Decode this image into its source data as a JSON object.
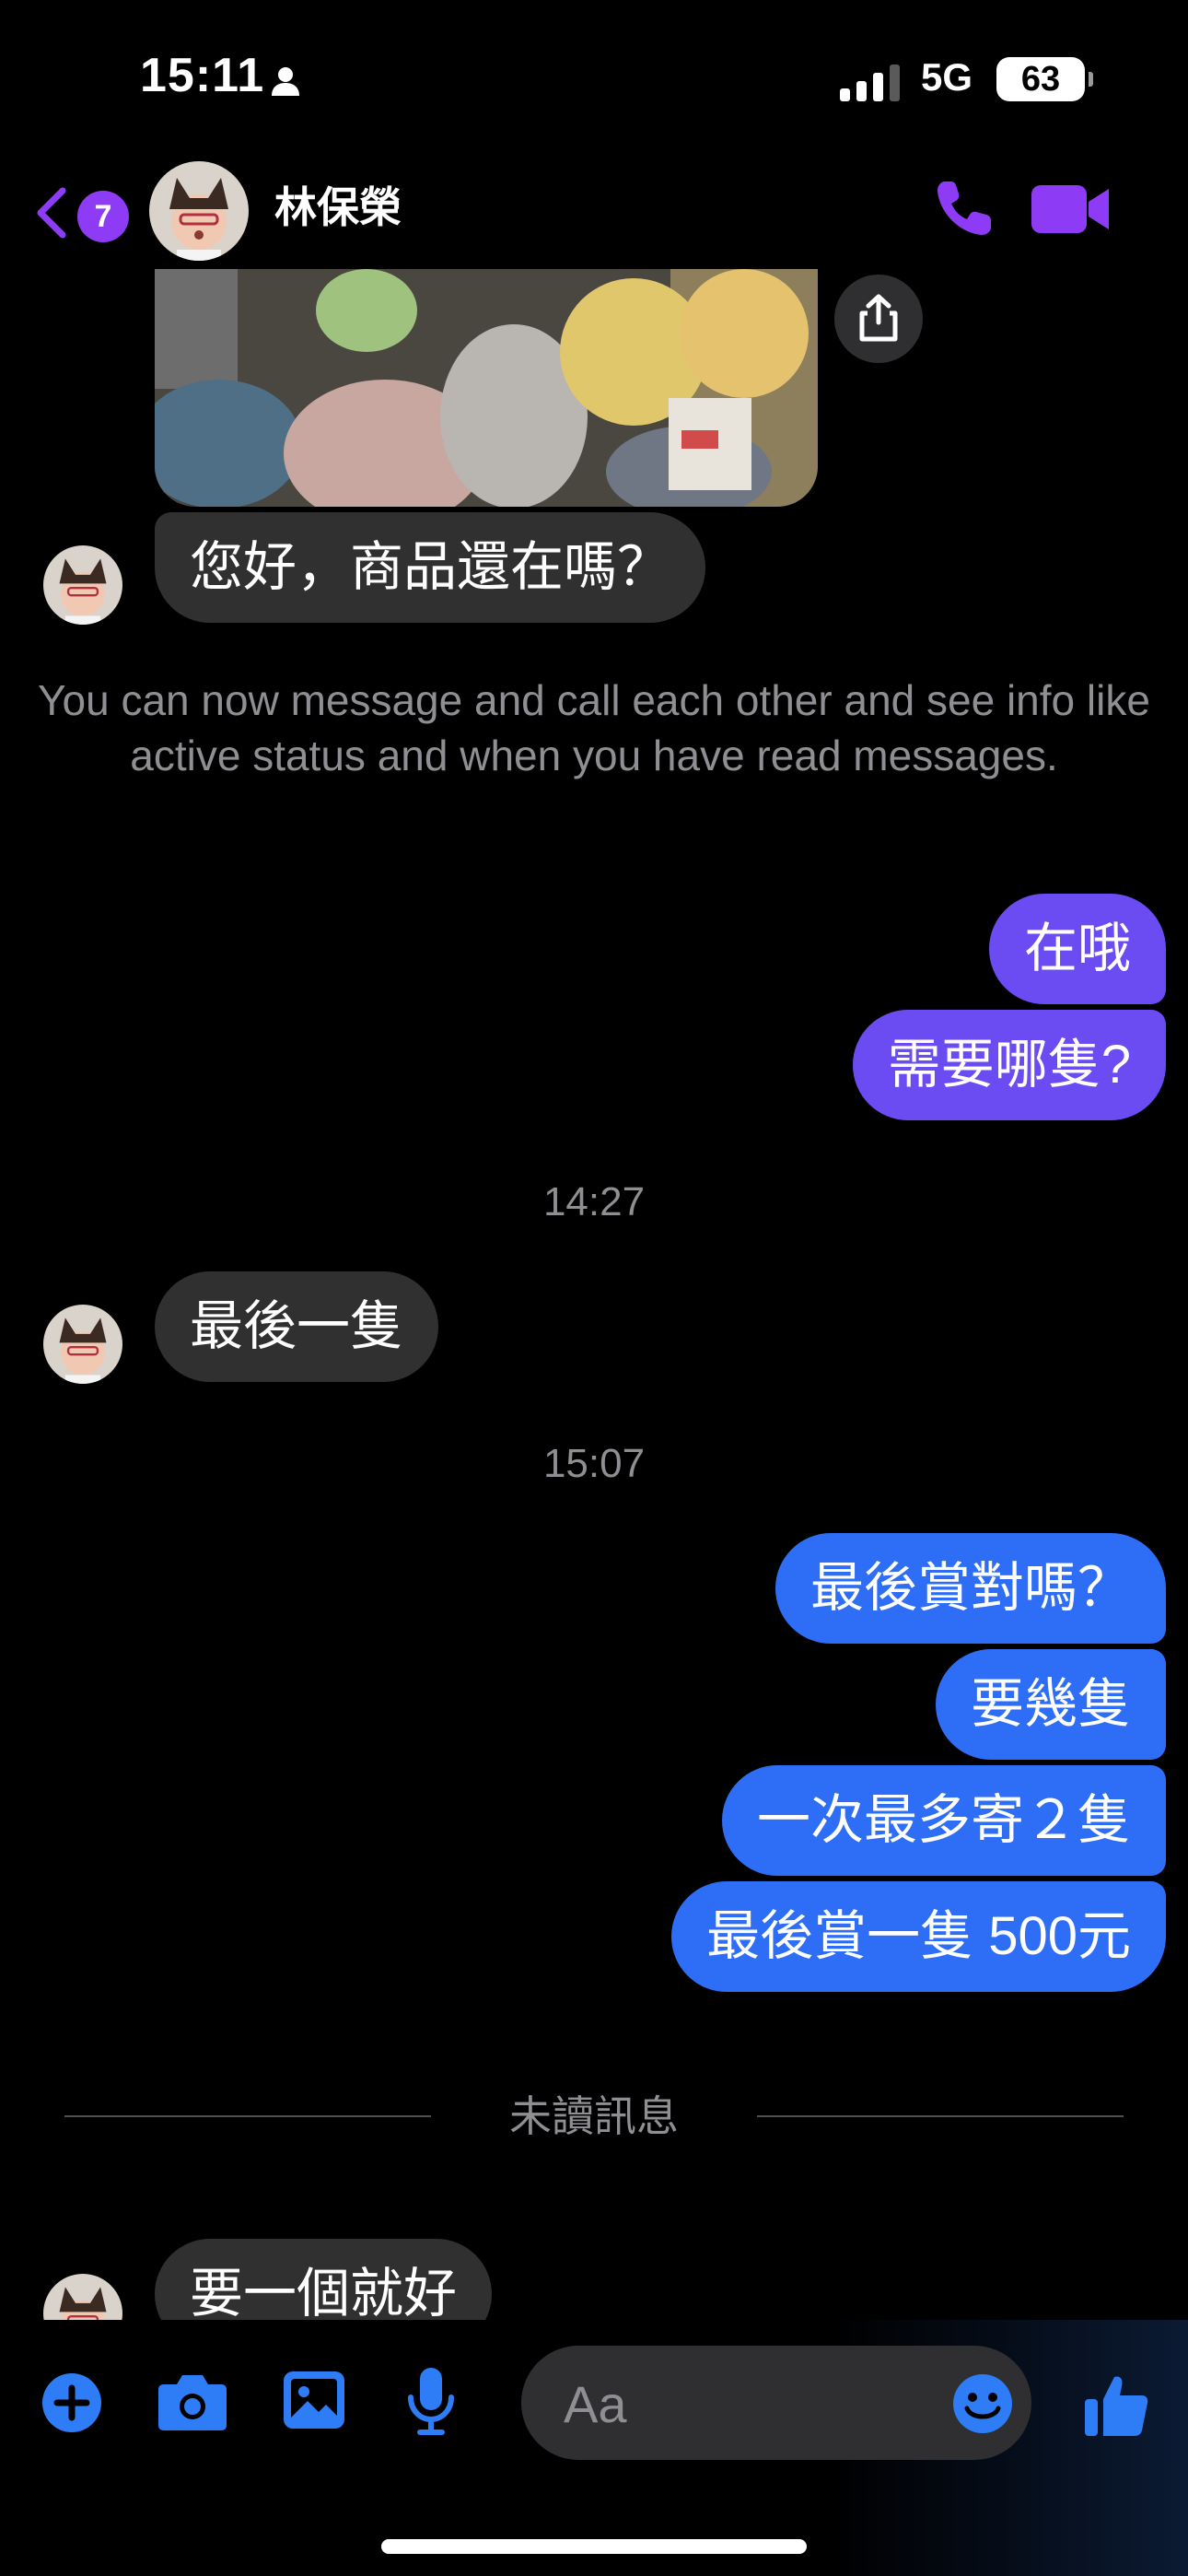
{
  "status_bar": {
    "time": "15:11",
    "network": "5G",
    "battery": "63"
  },
  "header": {
    "back_count": "7",
    "contact_name": "林保榮"
  },
  "messages": {
    "m1": "您好，商品還在嗎？",
    "system_note": "You can now message and call each other and see info like active status and when you have read messages.",
    "m2": "在哦",
    "m3": "需要哪隻?",
    "time1": "14:27",
    "m4": "最後一隻",
    "time2": "15:07",
    "m5": "最後賞對嗎？",
    "m6": "要幾隻",
    "m7": "一次最多寄２隻",
    "m8": "最後賞一隻 500元",
    "unread_label": "未讀訊息",
    "m9": "要一個就好"
  },
  "composer": {
    "placeholder": "Aa"
  },
  "colors": {
    "accent": "#8e3bf5",
    "outgoing_purple": "#6a4cf2",
    "outgoing_blue": "#2e6ef6",
    "incoming": "#303030",
    "composer_icon": "#2e7cf6"
  }
}
